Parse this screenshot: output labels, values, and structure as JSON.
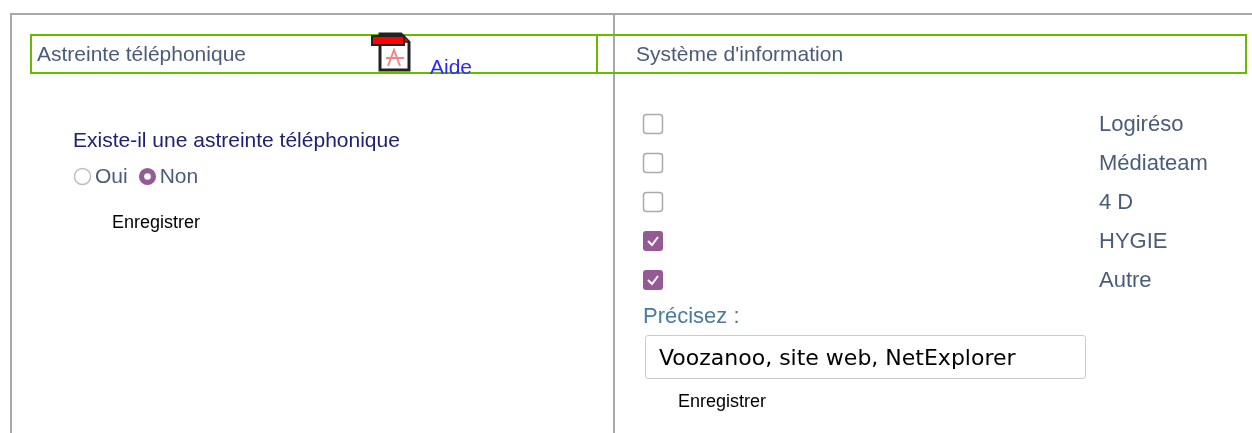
{
  "left_panel": {
    "title": "Astreinte téléphonique",
    "help_link": "Aide",
    "question": "Existe-il une astreinte téléphonique",
    "options": [
      {
        "label": "Oui",
        "selected": false
      },
      {
        "label": "Non",
        "selected": true
      }
    ],
    "save_button": "Enregistrer"
  },
  "right_panel": {
    "title": "Système d'information",
    "systems": [
      {
        "label": "Logiréso",
        "checked": false
      },
      {
        "label": "Médiateam",
        "checked": false
      },
      {
        "label": "4 D",
        "checked": false
      },
      {
        "label": "HYGIE",
        "checked": true
      },
      {
        "label": "Autre",
        "checked": true
      }
    ],
    "specify_label": "Précisez :",
    "specify_value": "Voozanoo, site web, NetExplorer",
    "save_button": "Enregistrer"
  }
}
